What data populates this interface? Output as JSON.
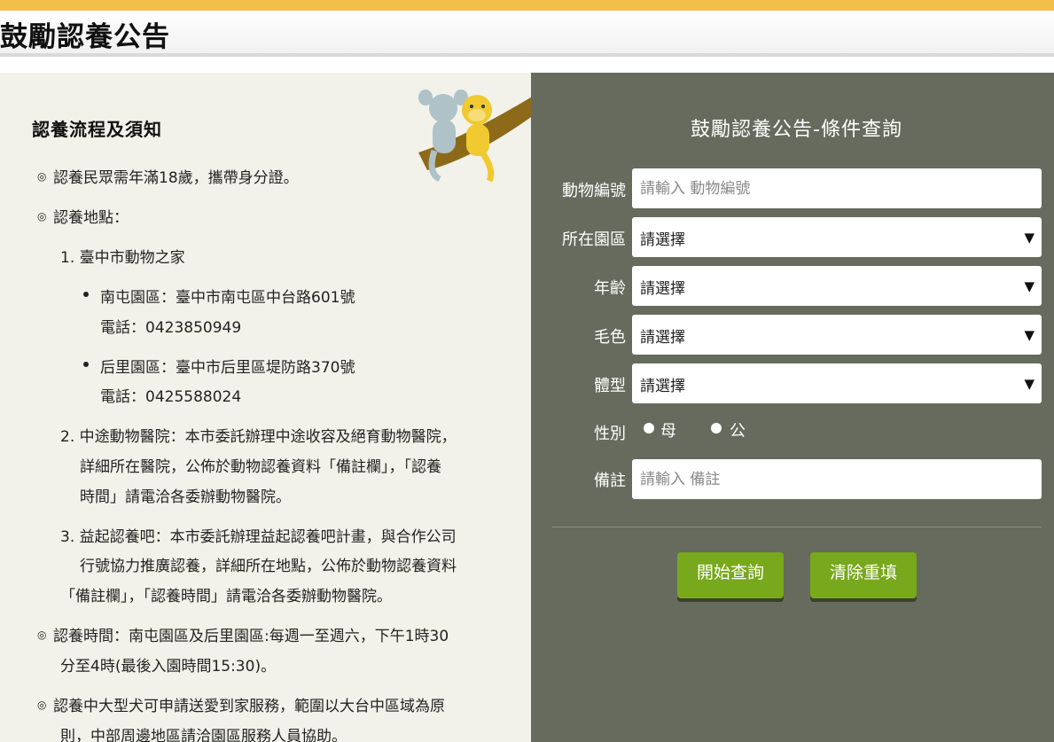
{
  "header": {
    "title": "鼓勵認養公告"
  },
  "info": {
    "title": "認養流程及須知",
    "age_requirement": "認養民眾需年滿18歲，攜帶身分證。",
    "locations_label": "認養地點：",
    "item1": {
      "title": "1. 臺中市動物之家",
      "nantun": {
        "line1": "南屯園區：臺中市南屯區中台路601號",
        "line2": "電話：0423850949"
      },
      "houli": {
        "line1": "后里園區：臺中市后里區堤防路370號",
        "line2": "電話：0425588024"
      }
    },
    "item2": {
      "line1": "2. 中途動物醫院：本市委託辦理中途收容及絕育動物醫院，",
      "line2": "詳細所在醫院，公佈於動物認養資料「備註欄」，「認養",
      "line3": "時間」請電洽各委辦動物醫院。"
    },
    "item3": {
      "line1": "3. 益起認養吧：本市委託辦理益起認養吧計畫，與合作公司",
      "line2": "行號協力推廣認養，詳細所在地點，公佈於動物認養資料",
      "line3": "「備註欄」，「認養時間」請電洽各委辦動物醫院。"
    },
    "hours": {
      "line1": "認養時間：南屯園區及后里園區:每週一至週六，下午1時30",
      "line2": "分至4時(最後入園時間15:30)。"
    },
    "delivery": {
      "line1": "認養中大型犬可申請送愛到家服務，範圍以大台中區域為原",
      "line2": "則，中部周邊地區請洽園區服務人員協助。"
    }
  },
  "search": {
    "title": "鼓勵認養公告-條件查詢",
    "animal_id": {
      "label": "動物編號",
      "placeholder": "請輸入 動物編號"
    },
    "area": {
      "label": "所在園區",
      "value": "請選擇"
    },
    "age": {
      "label": "年齡",
      "value": "請選擇"
    },
    "color": {
      "label": "毛色",
      "value": "請選擇"
    },
    "body": {
      "label": "體型",
      "value": "請選擇"
    },
    "sex": {
      "label": "性別",
      "female": "母",
      "male": "公"
    },
    "note": {
      "label": "備註",
      "placeholder": "請輸入 備註"
    },
    "search_button": "開始查詢",
    "reset_button": "清除重填"
  },
  "colors": {
    "top_bar": "#f2c04a",
    "left_bg": "#f2f2ea",
    "right_bg": "#676b5e",
    "button": "#78a81c"
  },
  "icons": {
    "bullet": "circle-bullet-icon",
    "dropdown": "triangle-down-icon"
  }
}
